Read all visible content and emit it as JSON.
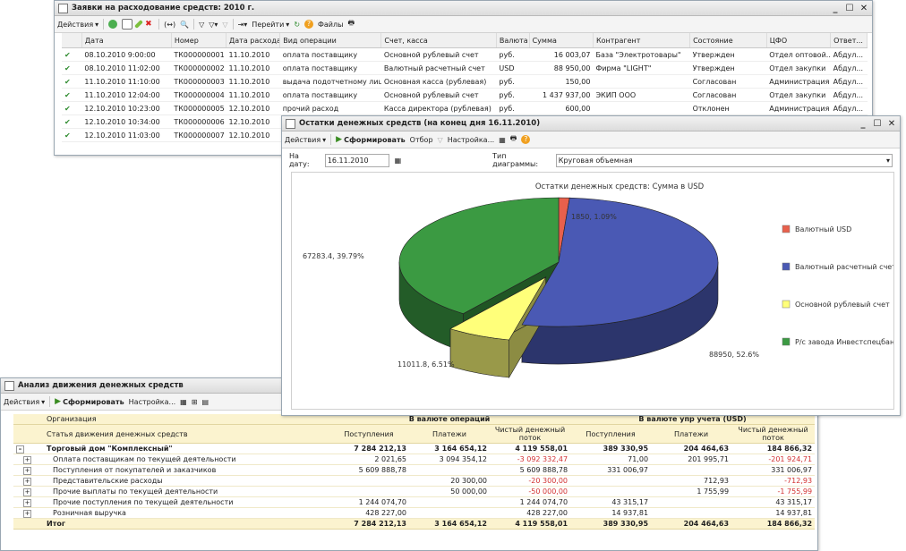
{
  "w1": {
    "title": "Заявки на расходование средств: 2010 г.",
    "toolbar": {
      "actions": "Действия",
      "goto": "Перейти",
      "files": "Файлы"
    },
    "columns": [
      "Дата",
      "Номер",
      "Дата расхода",
      "Вид операции",
      "Счет, касса",
      "Валюта",
      "Сумма",
      "Контрагент",
      "Состояние",
      "ЦФО",
      "Ответ..."
    ],
    "rows": [
      [
        "08.10.2010 9:00:00",
        "ТК000000001",
        "11.10.2010",
        "оплата поставщику",
        "Основной рублевый счет",
        "руб.",
        "16 003,07",
        "База \"Электротовары\"",
        "Утвержден",
        "Отдел оптовой...",
        "Абдул..."
      ],
      [
        "08.10.2010 11:02:00",
        "ТК000000002",
        "11.10.2010",
        "оплата поставщику",
        "Валютный расчетный счет",
        "USD",
        "88 950,00",
        "Фирма \"LIGHT\"",
        "Утвержден",
        "Отдел закупки",
        "Абдул..."
      ],
      [
        "11.10.2010 11:10:00",
        "ТК000000003",
        "11.10.2010",
        "выдача подотчетному лицу",
        "Основная касса (рублевая)",
        "руб.",
        "150,00",
        "",
        "Согласован",
        "Администрация",
        "Абдул..."
      ],
      [
        "11.10.2010 12:04:00",
        "ТК000000004",
        "11.10.2010",
        "оплата поставщику",
        "Основной рублевый счет",
        "руб.",
        "1 437 937,00",
        "ЭКИП ООО",
        "Согласован",
        "Отдел закупки",
        "Абдул..."
      ],
      [
        "12.10.2010 10:23:00",
        "ТК000000005",
        "12.10.2010",
        "прочий расход",
        "Касса директора (рублевая)",
        "руб.",
        "600,00",
        "",
        "Отклонен",
        "Администрация",
        "Абдул..."
      ],
      [
        "12.10.2010 10:34:00",
        "ТК000000006",
        "12.10.2010",
        "",
        "",
        "",
        "",
        "",
        "",
        "",
        ""
      ],
      [
        "12.10.2010 11:03:00",
        "ТК000000007",
        "12.10.2010",
        "",
        "",
        "",
        "",
        "",
        "",
        "",
        ""
      ]
    ]
  },
  "w2": {
    "title": "Остатки денежных средств (на конец дня 16.11.2010)",
    "toolbar": {
      "actions": "Действия",
      "generate": "Сформировать",
      "selection": "Отбор",
      "settings": "Настройка..."
    },
    "date_label": "На дату:",
    "date_value": "16.11.2010",
    "chart_type_label": "Тип диаграммы:",
    "chart_type_value": "Круговая объемная"
  },
  "w3": {
    "title": "Анализ движения денежных средств",
    "toolbar": {
      "actions": "Действия",
      "generate": "Сформировать",
      "settings": "Настройка..."
    },
    "hdr": {
      "org": "Организация",
      "article": "Статья движения денежных средств",
      "op_currency": "В валюте операций",
      "mgmt_currency": "В валюте упр учета (USD)",
      "receipts": "Поступления",
      "payments": "Платежи",
      "net": "Чистый денежный поток"
    },
    "rows": [
      {
        "name": "Торговый дом \"Комплексный\"",
        "sign": "–",
        "bold": true,
        "v": [
          "7 284 212,13",
          "3 164 654,12",
          "4 119 558,01",
          "389 330,95",
          "204 464,63",
          "184 866,32"
        ]
      },
      {
        "name": "Оплата поставщикам по текущей деятельности",
        "sign": "+",
        "bold": false,
        "v": [
          "2 021,65",
          "3 094 354,12",
          "-3 092 332,47",
          "71,00",
          "201 995,71",
          "-201 924,71"
        ]
      },
      {
        "name": "Поступления от покупателей и заказчиков",
        "sign": "+",
        "bold": false,
        "v": [
          "5 609 888,78",
          "",
          "5 609 888,78",
          "331 006,97",
          "",
          "331 006,97"
        ]
      },
      {
        "name": "Представительские расходы",
        "sign": "+",
        "bold": false,
        "v": [
          "",
          "20 300,00",
          "-20 300,00",
          "",
          "712,93",
          "-712,93"
        ]
      },
      {
        "name": "Прочие выплаты по текущей деятельности",
        "sign": "+",
        "bold": false,
        "v": [
          "",
          "50 000,00",
          "-50 000,00",
          "",
          "1 755,99",
          "-1 755,99"
        ]
      },
      {
        "name": "Прочие поступления по текущей деятельности",
        "sign": "+",
        "bold": false,
        "v": [
          "1 244 074,70",
          "",
          "1 244 074,70",
          "43 315,17",
          "",
          "43 315,17"
        ]
      },
      {
        "name": "Розничная выручка",
        "sign": "+",
        "bold": false,
        "v": [
          "428 227,00",
          "",
          "428 227,00",
          "14 937,81",
          "",
          "14 937,81"
        ]
      }
    ],
    "total": {
      "name": "Итог",
      "v": [
        "7 284 212,13",
        "3 164 654,12",
        "4 119 558,01",
        "389 330,95",
        "204 464,63",
        "184 866,32"
      ]
    }
  },
  "chart_data": {
    "type": "pie",
    "title": "Остатки денежных средств: Сумма в USD",
    "slices": [
      {
        "name": "Валютный USD",
        "value": 1850,
        "pct": 1.09,
        "label": "1850, 1.09%",
        "color": "#e8604c"
      },
      {
        "name": "Валютный расчетный счет",
        "value": 88950,
        "pct": 52.6,
        "label": "88950, 52.6%",
        "color": "#4a59b4"
      },
      {
        "name": "Основной рублевый счет",
        "value": 11011.8,
        "pct": 6.51,
        "label": "11011.8, 6.51%",
        "color": "#ffff7a"
      },
      {
        "name": "Р/с завода Инвестспецбанк",
        "value": 67283.4,
        "pct": 39.79,
        "label": "67283.4, 39.79%",
        "color": "#3b9a42"
      }
    ]
  }
}
